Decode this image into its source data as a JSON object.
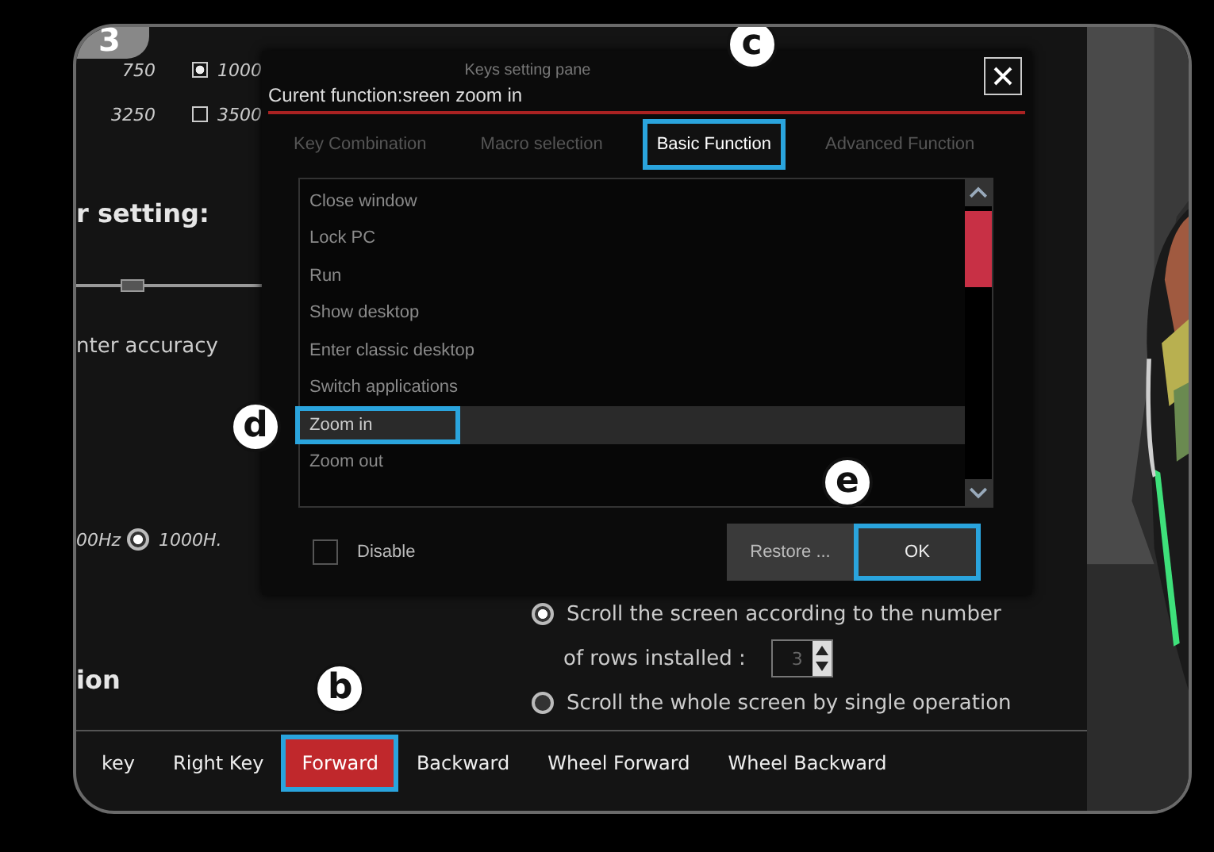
{
  "step_badge": "3",
  "dpi_options": [
    {
      "kind": "label",
      "label": "750"
    },
    {
      "kind": "checkbox",
      "label": "1000",
      "checked": true
    },
    {
      "kind": "label",
      "label": "3250"
    },
    {
      "kind": "checkbox",
      "label": "3500",
      "checked": false
    }
  ],
  "section_heading": "r setting:",
  "sensitivity_slider": {
    "level": 0.3
  },
  "accuracy_label": "nter accuracy",
  "polling_rates": [
    {
      "kind": "label",
      "label": "00Hz"
    },
    {
      "kind": "radio",
      "label": "1000H.",
      "selected": true
    }
  ],
  "section_heading_2": "ion",
  "scroll_options": [
    {
      "label": "Scroll the screen according to the number",
      "selected": true,
      "rows_label": "of rows installed :",
      "rows_value": "3"
    },
    {
      "label": "Scroll the whole screen by single operation",
      "selected": false
    }
  ],
  "button_tabs": [
    {
      "label": "key",
      "selected": false,
      "highlighted": false
    },
    {
      "label": "Right Key",
      "selected": false,
      "highlighted": false
    },
    {
      "label": "Forward",
      "selected": true,
      "highlighted": true,
      "callout": "b"
    },
    {
      "label": "Backward",
      "selected": false,
      "highlighted": false
    },
    {
      "label": "Wheel Forward",
      "selected": false,
      "highlighted": false
    },
    {
      "label": "Wheel Backward",
      "selected": false,
      "highlighted": false
    }
  ],
  "dialog": {
    "title": "Keys setting pane",
    "current_function": "Curent function:sreen zoom in",
    "tabs": [
      {
        "label": "Key Combination",
        "selected": false,
        "highlighted": false
      },
      {
        "label": "Macro selection",
        "selected": false,
        "highlighted": false
      },
      {
        "label": "Basic Function",
        "selected": true,
        "highlighted": true,
        "callout": "c"
      },
      {
        "label": "Advanced Function",
        "selected": false,
        "highlighted": false
      }
    ],
    "functions": [
      {
        "label": "Close window",
        "selected": false,
        "highlighted": false
      },
      {
        "label": "Lock PC",
        "selected": false,
        "highlighted": false
      },
      {
        "label": "Run",
        "selected": false,
        "highlighted": false
      },
      {
        "label": "Show desktop",
        "selected": false,
        "highlighted": false
      },
      {
        "label": "Enter classic desktop",
        "selected": false,
        "highlighted": false
      },
      {
        "label": "Switch applications",
        "selected": false,
        "highlighted": false
      },
      {
        "label": "Zoom in",
        "selected": true,
        "highlighted": true,
        "callout": "d"
      },
      {
        "label": "Zoom out",
        "selected": false,
        "highlighted": false
      }
    ],
    "disable": {
      "label": "Disable",
      "checked": false
    },
    "buttons": [
      {
        "label": "Restore ...",
        "highlighted": false
      },
      {
        "label": "OK",
        "highlighted": true,
        "callout": "e"
      }
    ]
  }
}
